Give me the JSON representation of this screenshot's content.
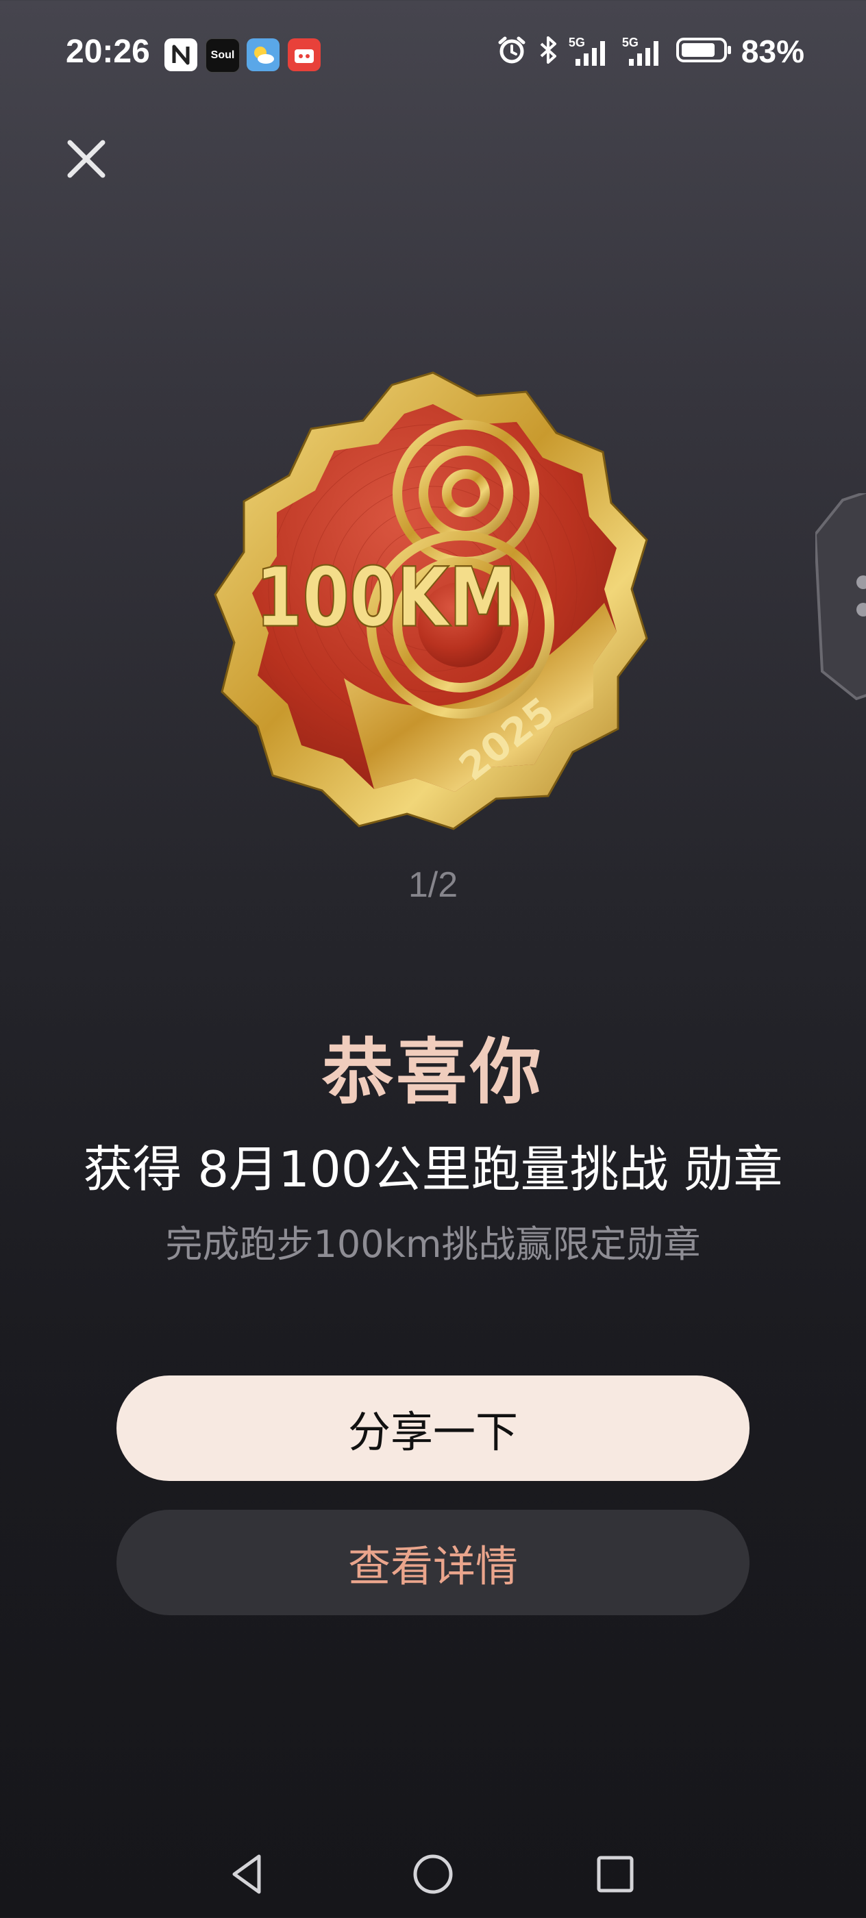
{
  "status_bar": {
    "time": "20:26",
    "app_icons": [
      "nfc-icon",
      "soul-app-icon",
      "weather-app-icon",
      "shopping-app-icon"
    ],
    "soul_label": "Soul",
    "system_icons": [
      "alarm-icon",
      "bluetooth-icon",
      "signal-5g-icon",
      "signal-5g-icon",
      "battery-icon"
    ],
    "signal_label": "5G",
    "battery_percent": "83%",
    "battery_level": 0.83
  },
  "close_icon": "close-icon",
  "medal": {
    "distance_label": "100KM",
    "year_label": "2025",
    "colors": {
      "face": "#c23b2a",
      "rim": "#d8b545"
    }
  },
  "pager": {
    "indicator": "1/2"
  },
  "congrats": {
    "title": "恭喜你",
    "award_line": "获得 8月100公里跑量挑战 勋章",
    "subtitle": "完成跑步100km挑战赢限定勋章"
  },
  "buttons": {
    "share_label": "分享一下",
    "details_label": "查看详情"
  },
  "colors": {
    "title": "#f0cdbd",
    "share_bg": "#f7e9e1",
    "details_bg": "#333338",
    "details_text": "#eaa58c"
  },
  "nav_bar": {
    "icons": [
      "back-icon",
      "home-icon",
      "recents-icon"
    ]
  }
}
